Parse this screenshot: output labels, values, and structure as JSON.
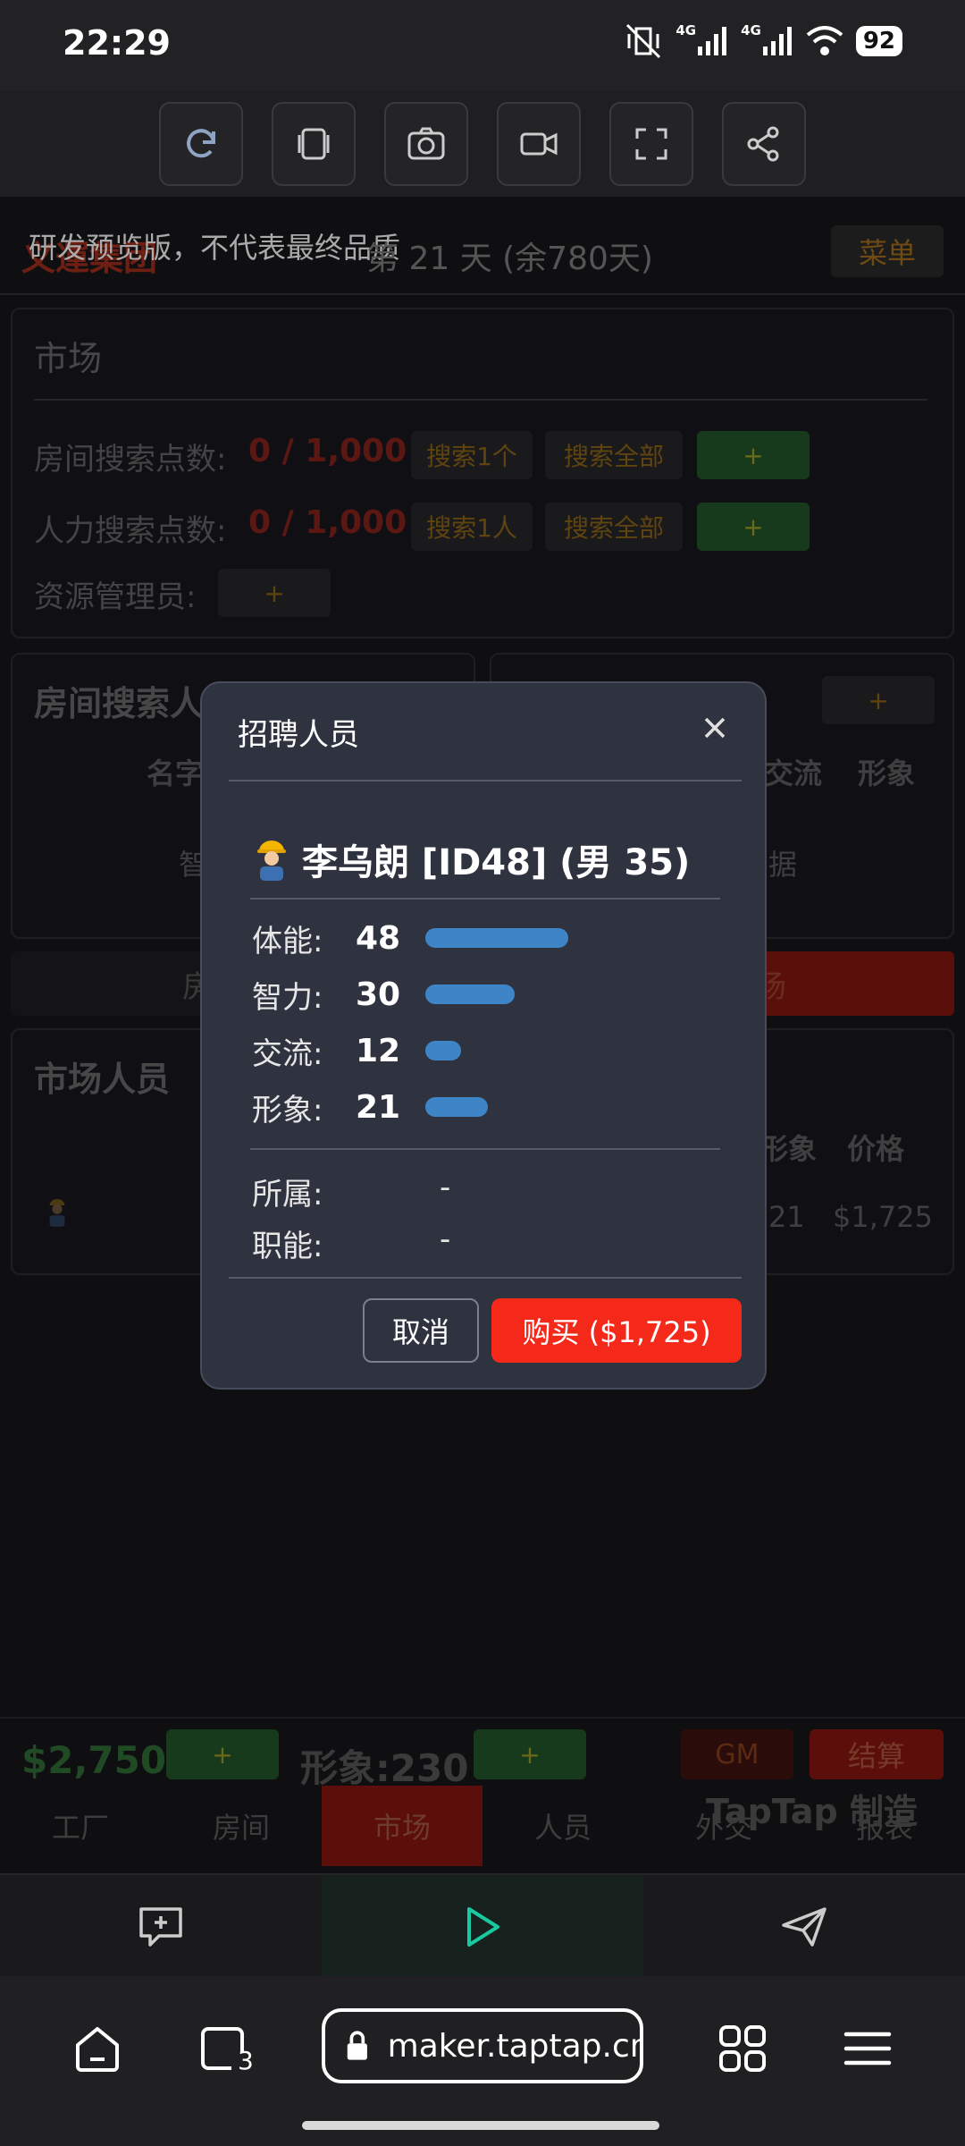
{
  "status_bar": {
    "time": "22:29",
    "net1": "4G",
    "net2": "4G",
    "battery": "92"
  },
  "game": {
    "title": "义運集团",
    "notice": "研发预览版，不代表最终品质",
    "day": "第 21 天 (余780天)",
    "menu": "菜单",
    "market_panel": {
      "title": "市场",
      "room_search_label": "房间搜索点数:",
      "room_search_value": "0 / 1,000",
      "search_one_room": "搜索1个",
      "search_all_1": "搜索全部",
      "plus": "+",
      "hr_search_label": "人力搜索点数:",
      "hr_search_value": "0 / 1,000",
      "search_one_person": "搜索1人",
      "search_all_2": "搜索全部",
      "resource_manager_label": "资源管理员:"
    },
    "room_search_panel": {
      "title": "房间搜索人",
      "col_name": "名字",
      "cell": "智"
    },
    "right_panel": {
      "col_comm": "交流",
      "col_image": "形象",
      "cell": "据"
    },
    "tab_left": "房",
    "tab_right": "场",
    "market_people": {
      "title": "市场人员",
      "col_image": "形象",
      "col_price": "价格",
      "row_image": "21",
      "row_price": "$1,725"
    },
    "bottom": {
      "money": "$2,750",
      "image_stat": "形象:230",
      "plus": "+",
      "gm": "GM",
      "settle": "结算",
      "tabs": [
        "工厂",
        "房间",
        "市场",
        "人员",
        "外交",
        "报表"
      ],
      "watermark": "TapTap 制造"
    }
  },
  "modal": {
    "title": "招聘人员",
    "name": "李乌朗 [ID48] (男 35)",
    "stats": [
      {
        "label": "体能:",
        "value": "48"
      },
      {
        "label": "智力:",
        "value": "30"
      },
      {
        "label": "交流:",
        "value": "12"
      },
      {
        "label": "形象:",
        "value": "21"
      }
    ],
    "belong_label": "所属:",
    "belong_value": "-",
    "role_label": "职能:",
    "role_value": "-",
    "cancel": "取消",
    "buy": "购买 ($1,725)"
  },
  "browser": {
    "url": "maker.taptap.cn/",
    "tabs_count": "3"
  },
  "colors": {
    "accent_red": "#f5291a",
    "stat_bar": "#3d85c6",
    "modal_bg": "#2f3340"
  }
}
